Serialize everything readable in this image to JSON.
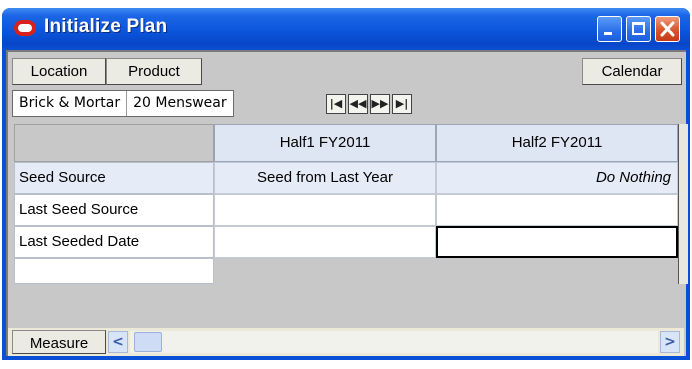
{
  "window": {
    "title": "Initialize Plan"
  },
  "toolbar": {
    "location_label": "Location",
    "product_label": "Product",
    "calendar_label": "Calendar"
  },
  "selector": {
    "location_value": "Brick & Mortar",
    "product_value": "20 Menswear"
  },
  "nav_icons": [
    "first-page-icon",
    "previous-page-icon",
    "next-page-icon",
    "last-page-icon"
  ],
  "grid": {
    "columns": [
      "Half1 FY2011",
      "Half2 FY2011"
    ],
    "rows": [
      {
        "label": "Seed Source",
        "values": [
          "Seed from Last Year",
          "Do Nothing"
        ]
      },
      {
        "label": "Last Seed Source",
        "values": [
          "",
          ""
        ]
      },
      {
        "label": "Last Seeded Date",
        "values": [
          "",
          ""
        ]
      }
    ]
  },
  "bottom": {
    "measure_label": "Measure"
  },
  "colors": {
    "titlebar": "#0a55db",
    "close_button": "#d8542c",
    "header_fill": "#dfe6f3"
  }
}
